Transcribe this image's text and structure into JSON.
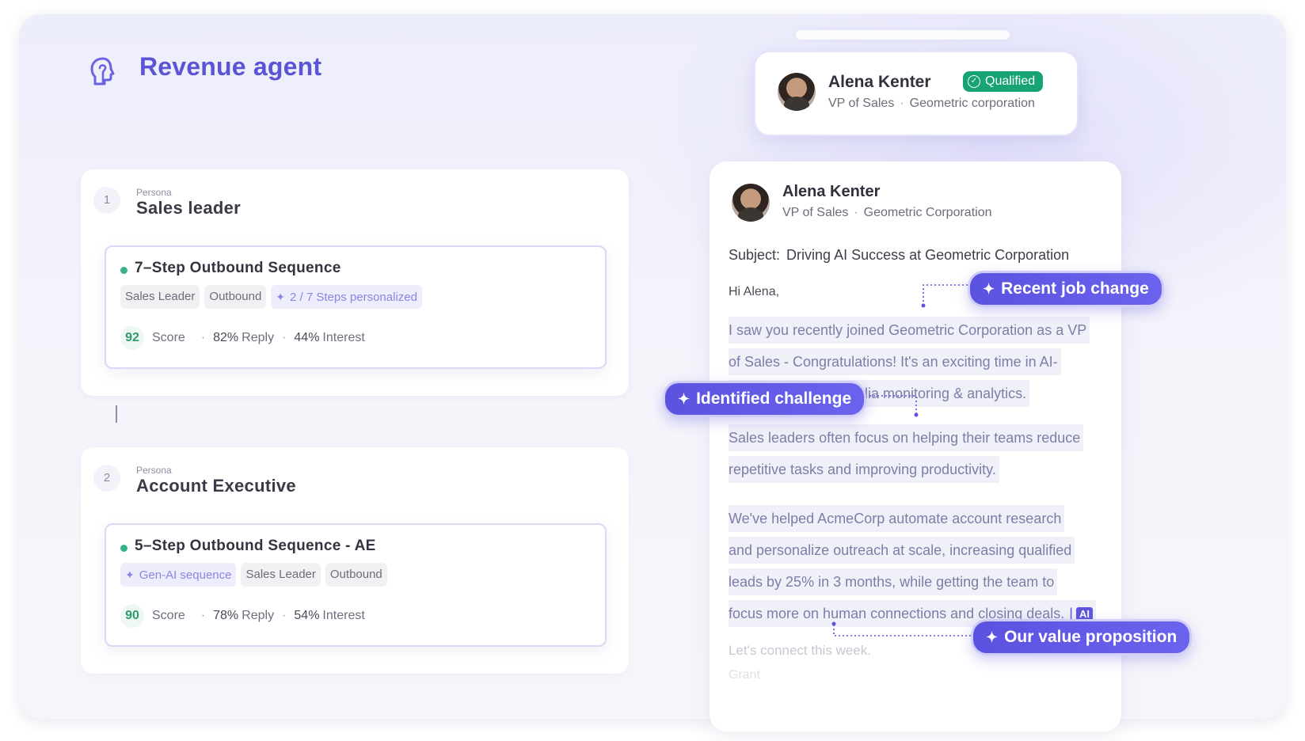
{
  "header": {
    "title": "Revenue agent",
    "icon": "head-profile-icon"
  },
  "personas": [
    {
      "number": "1",
      "kicker": "Persona",
      "title": "Sales leader",
      "sequence": {
        "title": "7–Step Outbound Sequence",
        "tags": [
          "Sales Leader",
          "Outbound"
        ],
        "ai_tag": "2 / 7  Steps personalized",
        "score": "92",
        "score_label": "Score",
        "reply_value": "82%",
        "reply_label": "Reply",
        "interest_value": "44%",
        "interest_label": "Interest"
      }
    },
    {
      "number": "2",
      "kicker": "Persona",
      "title": "Account Executive",
      "sequence": {
        "title": "5–Step Outbound Sequence - AE",
        "ai_tag": "Gen-AI sequence",
        "tags": [
          "Sales Leader",
          "Outbound"
        ],
        "score": "90",
        "score_label": "Score",
        "reply_value": "78%",
        "reply_label": "Reply",
        "interest_value": "54%",
        "interest_label": "Interest"
      }
    }
  ],
  "profile_card": {
    "name": "Alena Kenter",
    "role": "VP of Sales",
    "company": "Geometric corporation",
    "badge": "Qualified"
  },
  "email": {
    "name": "Alena Kenter",
    "role": "VP of Sales",
    "company": "Geometric Corporation",
    "subject_label": "Subject:",
    "subject": "Driving AI Success at Geometric Corporation",
    "greeting": "Hi Alena,",
    "para1": [
      "I saw you recently joined Geometric Corporation as a VP",
      "of Sales - Congratulations! It's an exciting time in AI-",
      "dia monitoring & analytics."
    ],
    "para2": [
      "Sales leaders often focus on helping their teams reduce",
      "repetitive tasks and improving productivity."
    ],
    "para3": [
      "We've helped AcmeCorp automate account research",
      "and personalize outreach at scale, increasing qualified",
      "leads by 25% in 3 months, while getting the team to",
      "focus more on human connections and closing deals."
    ],
    "ai_chip": "AI",
    "closing": "Let's connect this week.",
    "signoff": "Grant"
  },
  "annotations": {
    "job_change": "Recent job change",
    "challenge": "Identified challenge",
    "value_prop": "Our value proposition"
  },
  "colors": {
    "brand": "#5b55d6",
    "pill": "#5b53e0",
    "qualified": "#16a475",
    "score_green": "#2e9a6d"
  }
}
